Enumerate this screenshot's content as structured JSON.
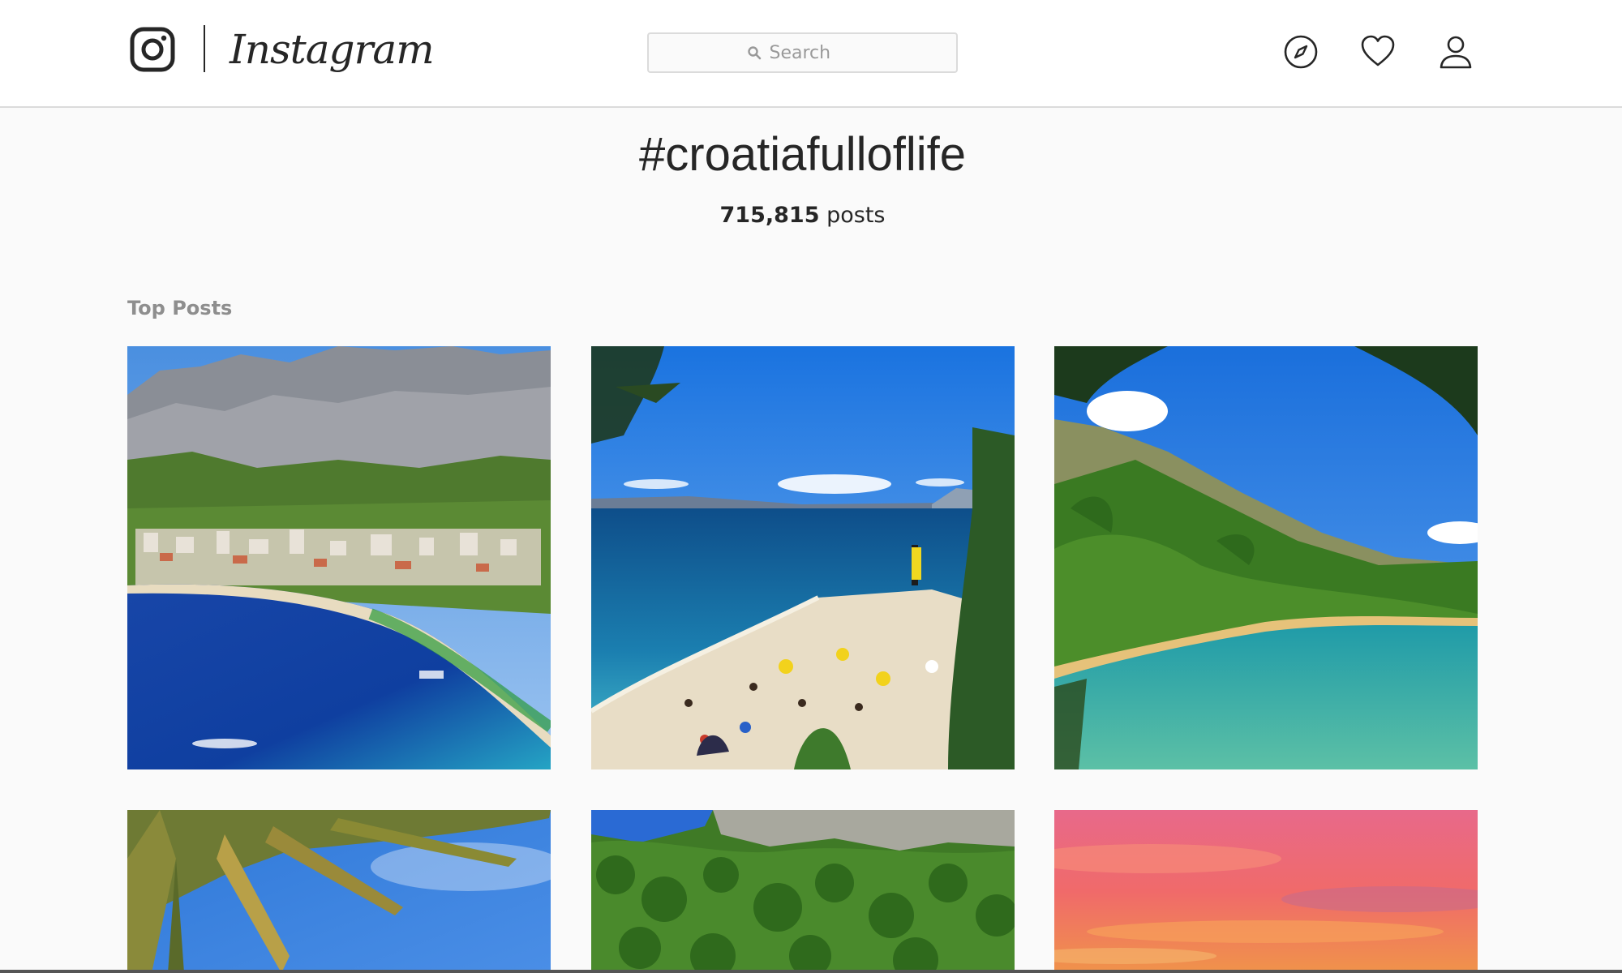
{
  "header": {
    "wordmark": "Instagram",
    "search_placeholder": "Search",
    "icons": [
      "camera-logo-icon",
      "compass-icon",
      "heart-icon",
      "person-icon"
    ]
  },
  "hashtag": {
    "title": "#croatiafulloflife",
    "count": "715,815",
    "count_suffix": "posts"
  },
  "top_posts": {
    "label": "Top Posts",
    "items": [
      {
        "scene": "coastal town below mountains with blue bay"
      },
      {
        "scene": "pebble beach with umbrellas and turquoise sea"
      },
      {
        "scene": "green pine hillside over a clear cove"
      },
      {
        "scene": "palm fronds against blue sky"
      },
      {
        "scene": "dense green forest under rocky cliff"
      },
      {
        "scene": "pink and orange sunset sky"
      }
    ]
  },
  "colors": {
    "page_bg": "#fafafa",
    "header_bg": "#ffffff",
    "border": "#dbdbdb",
    "text": "#262626",
    "muted": "#8e8e8e"
  }
}
